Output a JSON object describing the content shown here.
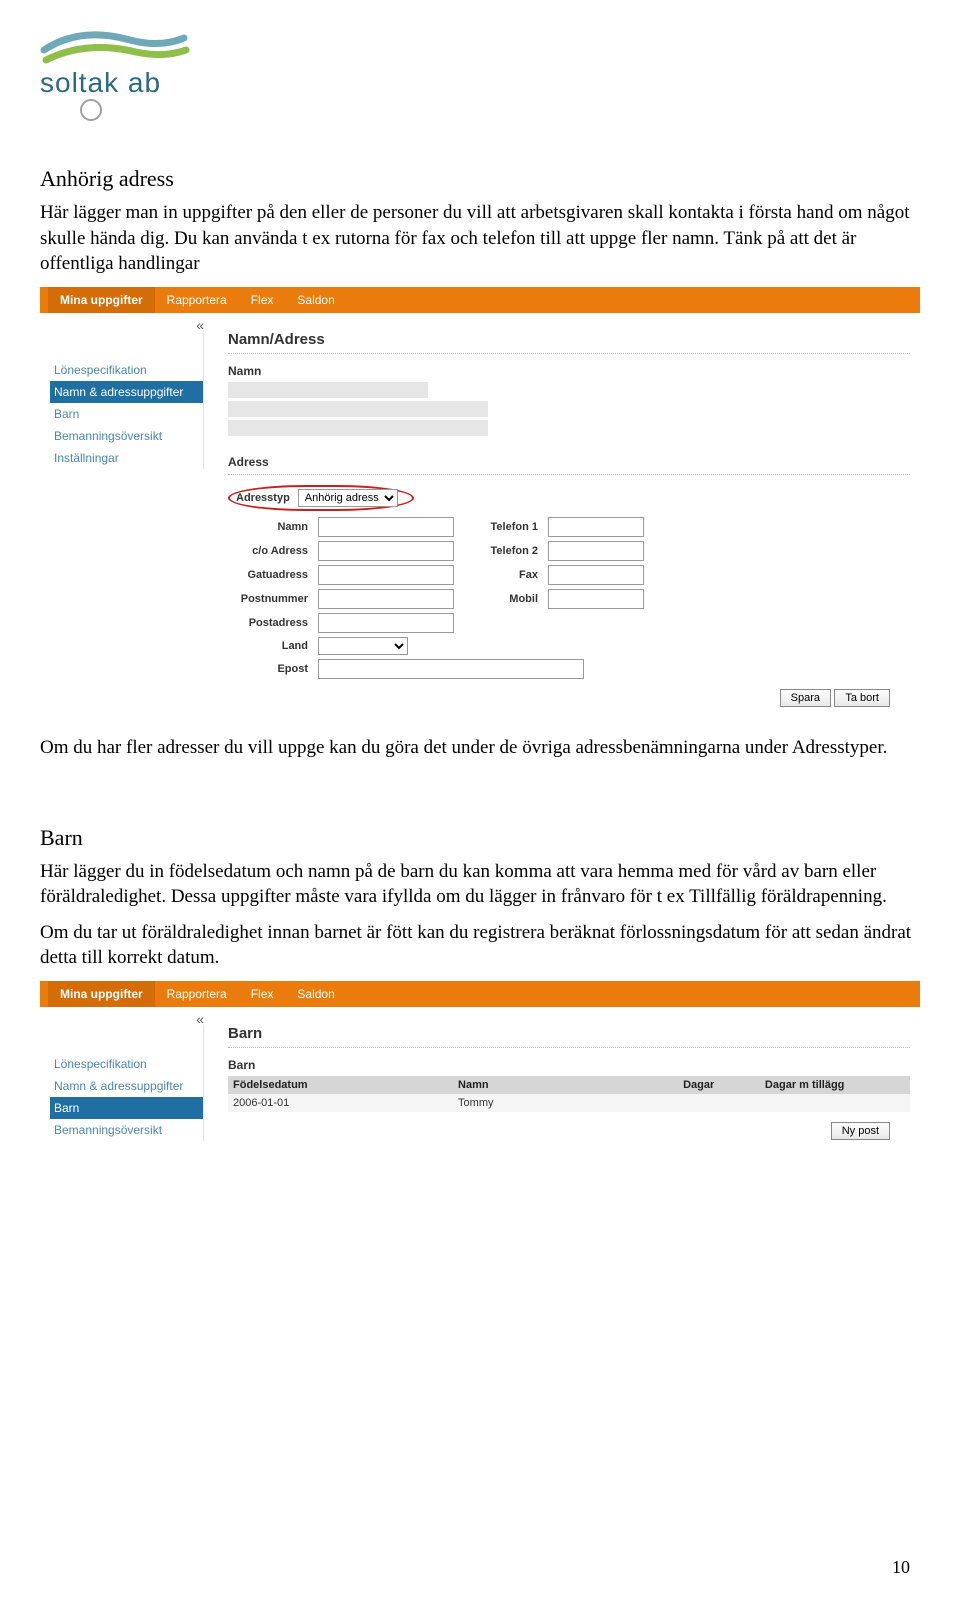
{
  "logo_text": "soltak ab",
  "section1": {
    "title": "Anhörig adress",
    "para": "Här lägger man in uppgifter på den eller de personer du vill att arbetsgivaren skall kontakta i första hand om något skulle hända dig. Du kan använda t ex rutorna för fax och telefon till att uppge fler namn. Tänk på att det är offentliga handlingar"
  },
  "nav": {
    "active": "Mina uppgifter",
    "items": [
      "Rapportera",
      "Flex",
      "Saldon"
    ]
  },
  "sidebar": {
    "collapse": "«",
    "items": [
      {
        "label": "Lönespecifikation",
        "active": false
      },
      {
        "label": "Namn & adressuppgifter",
        "active": true
      },
      {
        "label": "Barn",
        "active": false
      },
      {
        "label": "Bemanningsöversikt",
        "active": false
      },
      {
        "label": "Inställningar",
        "active": false
      }
    ]
  },
  "form1": {
    "section_title": "Namn/Adress",
    "sub_name": "Namn",
    "sub_address": "Adress",
    "addr_type_label": "Adresstyp",
    "addr_type_value": "Anhörig adress",
    "rows_left": [
      "Namn",
      "c/o Adress",
      "Gatuadress",
      "Postnummer",
      "Postadress",
      "Land",
      "Epost"
    ],
    "rows_right": [
      "Telefon 1",
      "Telefon 2",
      "Fax",
      "Mobil"
    ],
    "btn_save": "Spara",
    "btn_delete": "Ta bort"
  },
  "mid_para": "Om du har fler adresser du vill uppge kan du göra det under de övriga adressbenämningarna under Adresstyper.",
  "section2": {
    "title": "Barn",
    "para1": "Här lägger du in födelsedatum och namn på de barn du kan komma att vara hemma med för vård av barn eller föräldraledighet. Dessa uppgifter måste vara ifyllda om du lägger in frånvaro för t ex Tillfällig föräldrapenning.",
    "para2": "Om du tar ut föräldraledighet innan barnet är fött kan du registrera beräknat förlossningsdatum för att sedan ändrat detta till korrekt datum."
  },
  "sidebar2": {
    "items": [
      {
        "label": "Lönespecifikation",
        "active": false
      },
      {
        "label": "Namn & adressuppgifter",
        "active": false
      },
      {
        "label": "Barn",
        "active": true
      },
      {
        "label": "Bemanningsöversikt",
        "active": false
      }
    ]
  },
  "barn_panel": {
    "title": "Barn",
    "sub": "Barn",
    "headers": [
      "Födelsedatum",
      "Namn",
      "Dagar",
      "Dagar m tillägg"
    ],
    "row": [
      "2006-01-01",
      "Tommy",
      "",
      ""
    ],
    "btn_new": "Ny post"
  },
  "page_number": "10"
}
